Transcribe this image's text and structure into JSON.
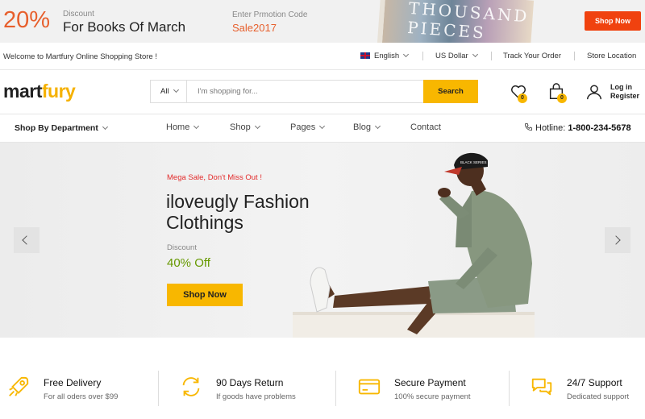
{
  "promo": {
    "percent": "20%",
    "discount_label": "Discount",
    "discount_title": "For Books Of March",
    "code_label": "Enter Prmotion Code",
    "code": "Sale2017",
    "book_text": "THOUSAND PIECES",
    "shop_now": "Shop Now",
    "accent": "#e75f2c",
    "button_color": "#f0420f"
  },
  "toplinks": {
    "welcome": "Welcome to Martfury Online Shopping Store !",
    "language": "English",
    "currency": "US Dollar",
    "track_order": "Track Your Order",
    "store_location": "Store Location"
  },
  "header": {
    "logo_part1": "mart",
    "logo_part2": "fury",
    "search_category": "All",
    "search_placeholder": "I'm shopping for...",
    "search_button": "Search",
    "wishlist_count": "0",
    "cart_count": "0",
    "login": "Log in",
    "register": "Register",
    "brand_color": "#f8b700"
  },
  "nav": {
    "department": "Shop By Department",
    "items": [
      "Home",
      "Shop",
      "Pages",
      "Blog",
      "Contact"
    ],
    "hotline_label": "Hotline:",
    "hotline_number": "1-800-234-5678"
  },
  "hero": {
    "kicker": "Mega Sale, Don't Miss Out !",
    "title_line1": "iloveugly Fashion",
    "title_line2": "Clothings",
    "discount_label": "Discount",
    "discount_value": "40% Off",
    "button": "Shop Now",
    "cap_text": "BLACK SERIES"
  },
  "features": [
    {
      "title": "Free Delivery",
      "subtitle": "For all oders over $99",
      "icon": "rocket-icon"
    },
    {
      "title": "90 Days Return",
      "subtitle": "If goods have problems",
      "icon": "return-icon"
    },
    {
      "title": "Secure Payment",
      "subtitle": "100% secure payment",
      "icon": "credit-card-icon"
    },
    {
      "title": "24/7 Support",
      "subtitle": "Dedicated support",
      "icon": "support-chat-icon"
    }
  ]
}
